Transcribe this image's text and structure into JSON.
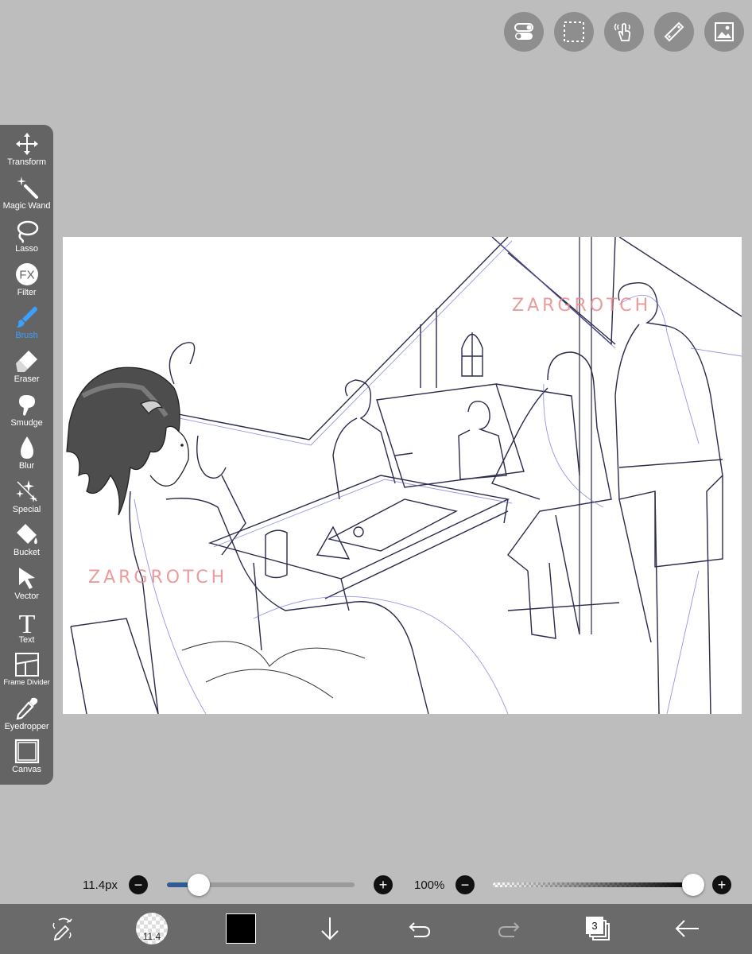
{
  "toolbar": {
    "items": [
      {
        "label": "Transform",
        "icon": "move-arrows-icon"
      },
      {
        "label": "Magic Wand",
        "icon": "magic-wand-icon"
      },
      {
        "label": "Lasso",
        "icon": "lasso-icon"
      },
      {
        "label": "Filter",
        "icon": "fx-icon",
        "glyph": "FX"
      },
      {
        "label": "Brush",
        "icon": "brush-icon",
        "active": true
      },
      {
        "label": "Eraser",
        "icon": "eraser-icon"
      },
      {
        "label": "Smudge",
        "icon": "smudge-icon"
      },
      {
        "label": "Blur",
        "icon": "blur-drop-icon"
      },
      {
        "label": "Special",
        "icon": "sparkle-icon"
      },
      {
        "label": "Bucket",
        "icon": "bucket-icon"
      },
      {
        "label": "Vector",
        "icon": "cursor-arrow-icon"
      },
      {
        "label": "Text",
        "icon": "text-t-icon",
        "glyph": "T"
      },
      {
        "label": "Frame Divider",
        "icon": "frame-divider-icon"
      },
      {
        "label": "Eyedropper",
        "icon": "eyedropper-icon"
      },
      {
        "label": "Canvas",
        "icon": "canvas-square-icon"
      }
    ],
    "active_color": "#3aa0ff"
  },
  "top_buttons": [
    "toggle-icon",
    "selection-icon",
    "gesture-hand-icon",
    "ruler-icon",
    "material-image-icon"
  ],
  "canvas": {
    "watermarks": [
      "ZARGROTCH",
      "ZARGROTCH"
    ],
    "watermark_color": "#e88a8a"
  },
  "brush_size": {
    "value": "11.4px",
    "fraction": 0.17,
    "minus": "−",
    "plus": "+"
  },
  "opacity": {
    "value": "100%",
    "fraction": 1.0,
    "minus": "−",
    "plus": "+"
  },
  "bottom_bar": {
    "brush_preview_value": "11.4",
    "current_color": "#000000",
    "layer_count": "3",
    "icons": [
      "swap-tools-icon",
      "brush-preview",
      "color-swatch",
      "download-arrow-icon",
      "undo-icon",
      "redo-icon",
      "layers-icon",
      "back-arrow-icon"
    ]
  }
}
